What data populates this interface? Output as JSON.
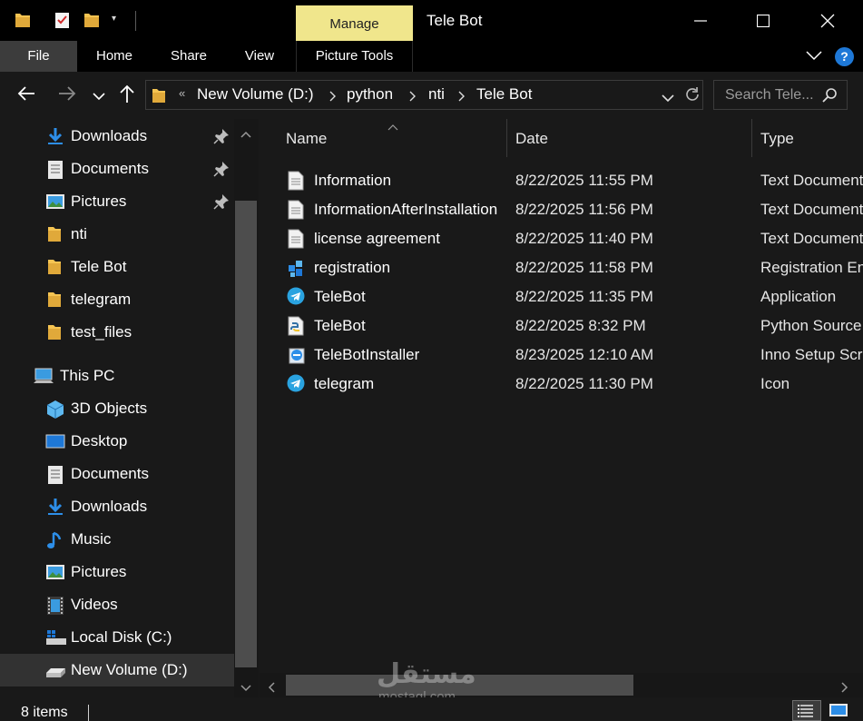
{
  "window": {
    "title": "Tele Bot",
    "manage_tab": "Manage"
  },
  "ribbon": {
    "tabs": [
      "File",
      "Home",
      "Share",
      "View",
      "Picture Tools"
    ],
    "help_label": "?"
  },
  "address": {
    "overflow": "«",
    "crumbs": [
      "New Volume (D:)",
      "python",
      "nti",
      "Tele Bot"
    ]
  },
  "search": {
    "placeholder": "Search Tele..."
  },
  "nav_pane": {
    "items": [
      {
        "label": "Downloads",
        "icon": "download-arrow-icon",
        "pinned": true
      },
      {
        "label": "Documents",
        "icon": "documents-icon",
        "pinned": true
      },
      {
        "label": "Pictures",
        "icon": "pictures-icon",
        "pinned": true
      },
      {
        "label": "nti",
        "icon": "folder-icon",
        "pinned": false
      },
      {
        "label": "Tele Bot",
        "icon": "folder-icon",
        "pinned": false
      },
      {
        "label": "telegram",
        "icon": "folder-icon",
        "pinned": false
      },
      {
        "label": "test_files",
        "icon": "folder-icon",
        "pinned": false
      },
      {
        "label": "This PC",
        "icon": "computer-icon",
        "pinned": false
      },
      {
        "label": "3D Objects",
        "icon": "3d-objects-icon",
        "pinned": false
      },
      {
        "label": "Desktop",
        "icon": "desktop-icon",
        "pinned": false
      },
      {
        "label": "Documents",
        "icon": "documents-icon",
        "pinned": false
      },
      {
        "label": "Downloads",
        "icon": "download-arrow-icon",
        "pinned": false
      },
      {
        "label": "Music",
        "icon": "music-note-icon",
        "pinned": false
      },
      {
        "label": "Pictures",
        "icon": "pictures-icon",
        "pinned": false
      },
      {
        "label": "Videos",
        "icon": "videos-icon",
        "pinned": false
      },
      {
        "label": "Local Disk (C:)",
        "icon": "windows-drive-icon",
        "pinned": false
      },
      {
        "label": "New Volume (D:)",
        "icon": "drive-icon",
        "pinned": false,
        "selected": true
      }
    ]
  },
  "file_list": {
    "columns": [
      "Name",
      "Date",
      "Type"
    ],
    "rows": [
      {
        "name": "Information",
        "date": "8/22/2025 11:55 PM",
        "type": "Text Document",
        "icon": "text-file-icon"
      },
      {
        "name": "InformationAfterInstallation",
        "date": "8/22/2025 11:56 PM",
        "type": "Text Document",
        "icon": "text-file-icon"
      },
      {
        "name": "license agreement",
        "date": "8/22/2025 11:40 PM",
        "type": "Text Document",
        "icon": "text-file-icon"
      },
      {
        "name": "registration",
        "date": "8/22/2025 11:58 PM",
        "type": "Registration Entries",
        "icon": "registry-icon"
      },
      {
        "name": "TeleBot",
        "date": "8/22/2025 11:35 PM",
        "type": "Application",
        "icon": "telegram-icon"
      },
      {
        "name": "TeleBot",
        "date": "8/22/2025 8:32 PM",
        "type": "Python Source File",
        "icon": "python-file-icon"
      },
      {
        "name": "TeleBotInstaller",
        "date": "8/23/2025 12:10 AM",
        "type": "Inno Setup Script",
        "icon": "inno-setup-icon"
      },
      {
        "name": "telegram",
        "date": "8/22/2025 11:30 PM",
        "type": "Icon",
        "icon": "telegram-icon"
      }
    ]
  },
  "status": {
    "item_count": "8 items"
  },
  "watermark": {
    "arabic": "مستقل",
    "latin": "mostaql.com"
  },
  "colors": {
    "background": "#191919",
    "titlebar": "#000000",
    "manage_tab": "#f0e68c",
    "folder": "#f5c452",
    "selection": "#323232",
    "accent_blue": "#1e78d7"
  }
}
